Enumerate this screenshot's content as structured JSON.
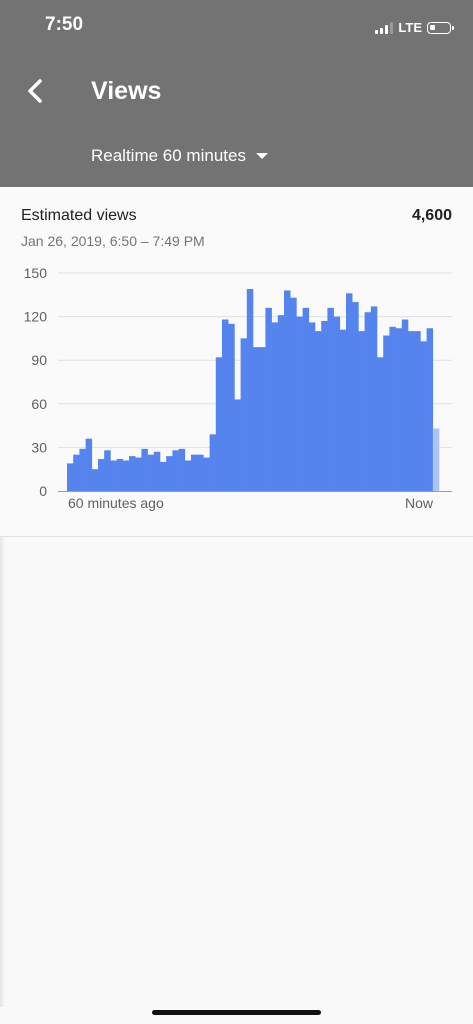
{
  "status_bar": {
    "time": "7:50",
    "network": "LTE"
  },
  "header": {
    "title": "Views",
    "range_selector": "Realtime 60 minutes"
  },
  "card": {
    "metric_label": "Estimated views",
    "metric_value": "4,600",
    "date_range": "Jan 26, 2019, 6:50 – 7:49 PM"
  },
  "colors": {
    "header_bg": "#737373",
    "bar": "#5584ee",
    "bar_current": "#a9c4f5"
  },
  "icons": {
    "back": "chevron-left-icon",
    "dropdown": "caret-down-icon",
    "signal": "signal-icon",
    "battery": "battery-icon"
  },
  "chart_data": {
    "type": "bar",
    "ylim": [
      0,
      150
    ],
    "yticks": [
      0,
      30,
      60,
      90,
      120,
      150
    ],
    "xlabel_start": "60 minutes ago",
    "xlabel_end": "Now",
    "grid": true,
    "values": [
      19,
      25,
      29,
      36,
      15,
      22,
      28,
      21,
      22,
      21,
      24,
      23,
      29,
      25,
      27,
      20,
      24,
      28,
      29,
      21,
      25,
      25,
      23,
      39,
      92,
      118,
      115,
      63,
      105,
      139,
      99,
      99,
      126,
      116,
      121,
      138,
      133,
      120,
      126,
      116,
      110,
      117,
      126,
      120,
      111,
      136,
      130,
      110,
      123,
      127,
      92,
      107,
      113,
      112,
      118,
      110,
      110,
      103,
      112,
      43
    ],
    "current_index": 59
  }
}
